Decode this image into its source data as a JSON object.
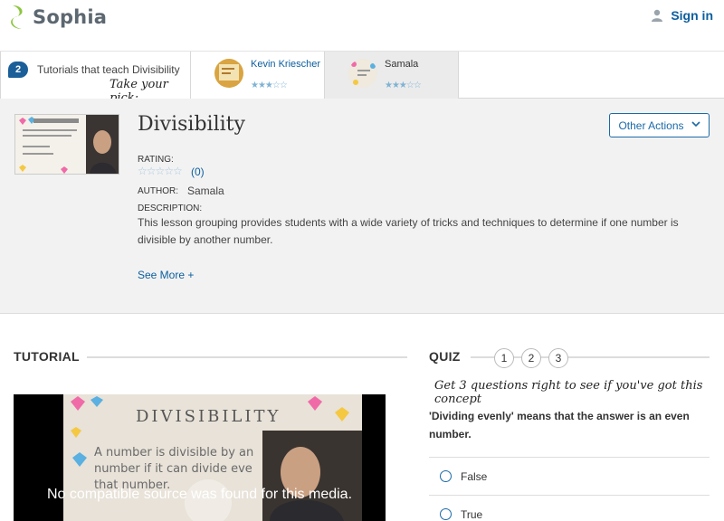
{
  "header": {
    "brand": "Sophia",
    "signin_label": "Sign in"
  },
  "tutorial_strip": {
    "count": "2",
    "title": "Tutorials that teach Divisibility",
    "pick_label": "Take your pick:",
    "cards": [
      {
        "author": "Kevin Kriescher",
        "stars": "★★★☆☆"
      },
      {
        "author": "Samala",
        "stars": "★★★☆☆"
      }
    ]
  },
  "lesson": {
    "title": "Divisibility",
    "actions_label": "Other Actions",
    "rating_label": "RATING:",
    "rating_stars": "☆☆☆☆☆",
    "rating_count": "(0)",
    "author_label": "AUTHOR:",
    "author": "Samala",
    "description_label": "DESCRIPTION:",
    "description": "This lesson grouping provides students with a wide variety of tricks and techniques to determine if one number is divisible by another number.",
    "see_more": "See More +"
  },
  "tutorial": {
    "heading": "TUTORIAL",
    "video_message": "No compatible source was found for this media."
  },
  "quiz": {
    "heading": "QUIZ",
    "steps": [
      "1",
      "2",
      "3"
    ],
    "tagline": "Get 3 questions right to see if you've got this concept",
    "question": "'Dividing evenly' means that the answer is an even number.",
    "options": [
      "False",
      "True"
    ]
  },
  "colors": {
    "brand_green": "#8cc63f",
    "link_blue": "#0b5e9e",
    "accent_blue": "#1b6aa8"
  }
}
